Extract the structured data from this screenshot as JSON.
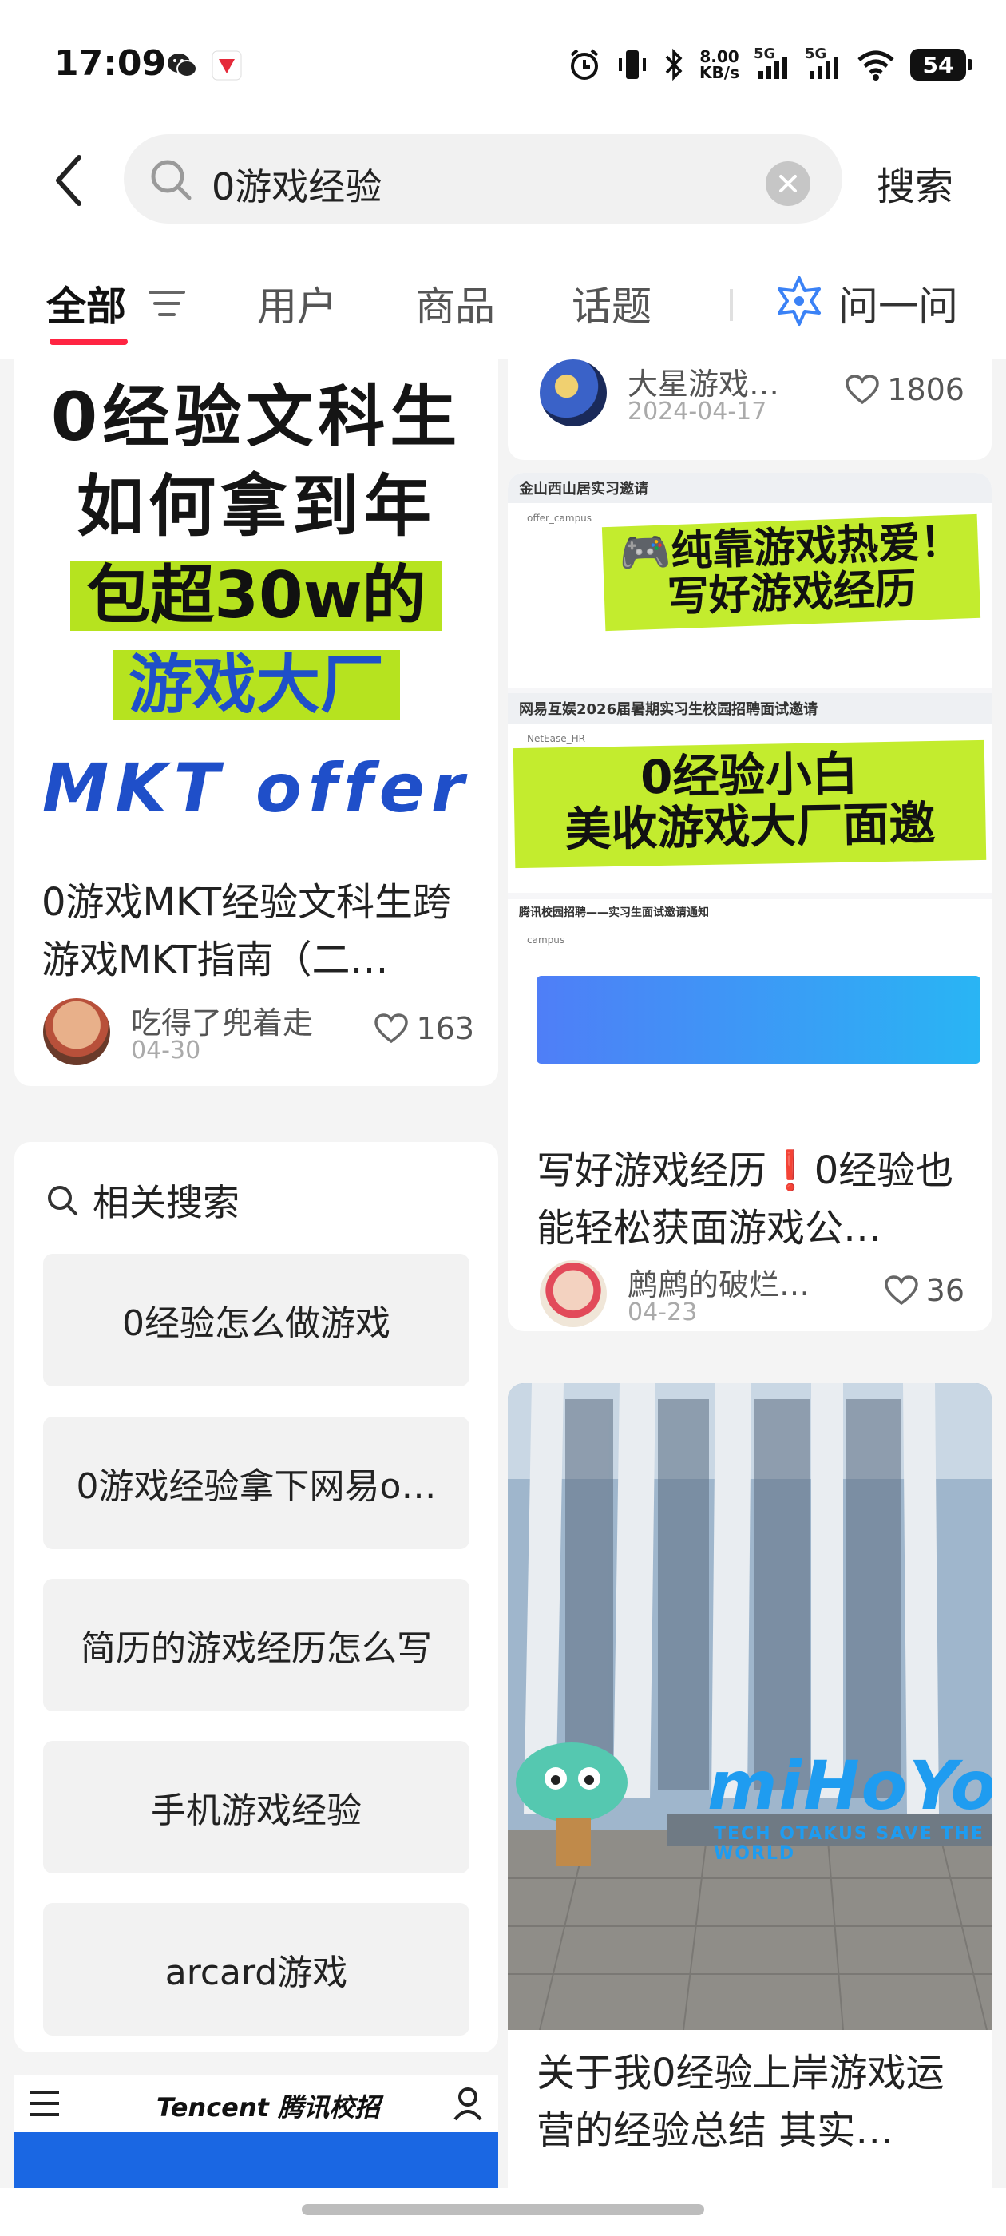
{
  "status_bar": {
    "time": "17:09",
    "net_speed_value": "8.00",
    "net_speed_unit": "KB/s",
    "sim1": "5G",
    "sim2": "5G",
    "battery": "54"
  },
  "search": {
    "query": "0游戏经验",
    "submit_label": "搜索"
  },
  "tabs": [
    {
      "label": "全部",
      "active": true
    },
    {
      "label": "用户"
    },
    {
      "label": "商品"
    },
    {
      "label": "话题"
    }
  ],
  "ask": {
    "label": "问一问"
  },
  "colors": {
    "accent": "#ff2442",
    "highlight_green": "#c3ec2e",
    "cover_blue": "#1f4fc9"
  },
  "feed_left": {
    "post1": {
      "cover_lines": [
        "0经验文科生",
        "如何拿到年",
        "包超30w的",
        "游戏大厂",
        "MKT offer"
      ],
      "title": "0游戏MKT经验文科生跨游戏MKT指南（二…",
      "author": "吃得了兜着走",
      "date": "04-30",
      "likes": "163"
    },
    "related": {
      "heading": "相关搜索",
      "items": [
        "0经验怎么做游戏",
        "0游戏经验拿下网易o…",
        "简历的游戏经历怎么写",
        "手机游戏经验",
        "arcard游戏"
      ]
    },
    "ad": {
      "brand": "Tencent 腾讯校招"
    }
  },
  "feed_right": {
    "post0": {
      "author": "大星游戏…",
      "date": "2024-04-17",
      "likes": "1806"
    },
    "post2": {
      "mail1_header": "金山西山居实习邀请",
      "mail1_sender": "offer_campus",
      "banner1_line1": "🎮纯靠游戏热爱！",
      "banner1_line2": "写好游戏经历",
      "mail2_header": "网易互娱2026届暑期实习生校园招聘面试邀请",
      "mail2_sender": "NetEase_HR",
      "banner2_line1": "0经验小白",
      "banner2_line2": "美收游戏大厂面邀",
      "mail3_header": "腾讯校园招聘——实习生面试邀请通知",
      "mail3_sender": "campus",
      "title": "写好游戏经历❗0经验也能轻松获面游戏公…",
      "author": "鹧鹧的破烂…",
      "date": "04-23",
      "likes": "36"
    },
    "post3": {
      "sign_text": "miHoYo",
      "sign_sub": "TECH OTAKUS SAVE THE WORLD",
      "title": "关于我0经验上岸游戏运营的经验总结 其实…"
    }
  }
}
